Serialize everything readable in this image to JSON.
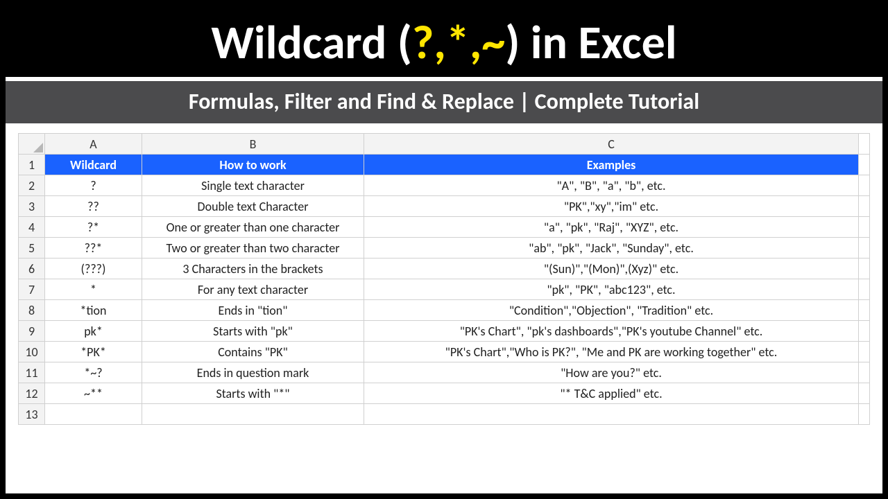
{
  "title": {
    "pre": "Wildcard (",
    "accent": "?,*,~",
    "post": ") in Excel"
  },
  "subtitle": "Formulas, Filter and Find & Replace | Complete Tutorial",
  "colLetters": [
    "A",
    "B",
    "C"
  ],
  "headers": {
    "a": "Wildcard",
    "b": "How to work",
    "c": "Examples"
  },
  "rows": [
    {
      "n": "1"
    },
    {
      "n": "2",
      "a": "?",
      "b": "Single text character",
      "c": "\"A\", \"B\", \"a\", \"b\", etc."
    },
    {
      "n": "3",
      "a": "??",
      "b": "Double text Character",
      "c": "\"PK\",\"xy\",\"im\" etc."
    },
    {
      "n": "4",
      "a": "?*",
      "b": "One or greater than one character",
      "c": "\"a\", \"pk\", \"Raj\", \"XYZ\", etc."
    },
    {
      "n": "5",
      "a": "??*",
      "b": "Two or greater than two character",
      "c": "\"ab\", \"pk\", \"Jack\", \"Sunday\", etc."
    },
    {
      "n": "6",
      "a": "(???)",
      "b": "3 Characters in the brackets",
      "c": "\"(Sun)\",\"(Mon)\",(Xyz)\" etc."
    },
    {
      "n": "7",
      "a": "*",
      "b": "For any text character",
      "c": "\"pk\", \"PK\", \"abc123\", etc."
    },
    {
      "n": "8",
      "a": "*tion",
      "b": "Ends in \"tion\"",
      "c": "\"Condition\",\"Objection\", \"Tradition\" etc."
    },
    {
      "n": "9",
      "a": "pk*",
      "b": "Starts with \"pk\"",
      "c": "\"PK's Chart\", \"pk's dashboards\",\"PK's youtube Channel\" etc."
    },
    {
      "n": "10",
      "a": "*PK*",
      "b": "Contains \"PK\"",
      "c": "\"PK's Chart\",\"Who is PK?\", \"Me and PK are working together\" etc."
    },
    {
      "n": "11",
      "a": "*~?",
      "b": "Ends in question mark",
      "c": "\"How are you?\" etc."
    },
    {
      "n": "12",
      "a": "~**",
      "b": "Starts with \"*\"",
      "c": "\"* T&C applied\" etc."
    },
    {
      "n": "13",
      "a": "",
      "b": "",
      "c": ""
    }
  ]
}
